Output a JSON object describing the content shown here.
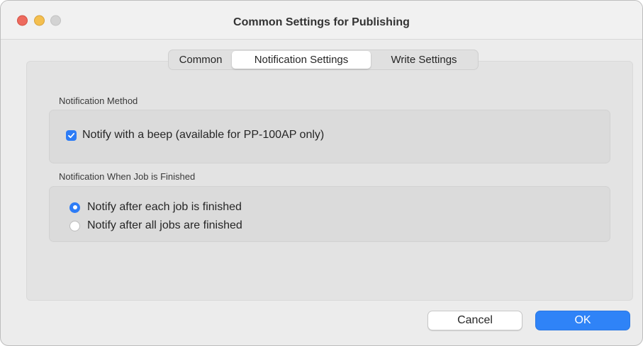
{
  "window": {
    "title": "Common Settings for Publishing"
  },
  "tabs": [
    {
      "label": "Common",
      "selected": false
    },
    {
      "label": "Notification Settings",
      "selected": true
    },
    {
      "label": "Write Settings",
      "selected": false
    }
  ],
  "notification_method": {
    "label": "Notification Method",
    "beep_checkbox": {
      "label": "Notify with a beep (available for PP-100AP only)",
      "checked": true
    }
  },
  "job_finished": {
    "label": "Notification When Job is Finished",
    "options": [
      {
        "label": "Notify after each job is finished",
        "selected": true
      },
      {
        "label": "Notify after all jobs are finished",
        "selected": false
      }
    ]
  },
  "buttons": {
    "cancel_label": "Cancel",
    "ok_label": "OK"
  },
  "colors": {
    "accent": "#2f83f7",
    "close": "#ed6a5e",
    "minimize": "#f4bf4f",
    "zoom_disabled": "#d3d3d3"
  }
}
